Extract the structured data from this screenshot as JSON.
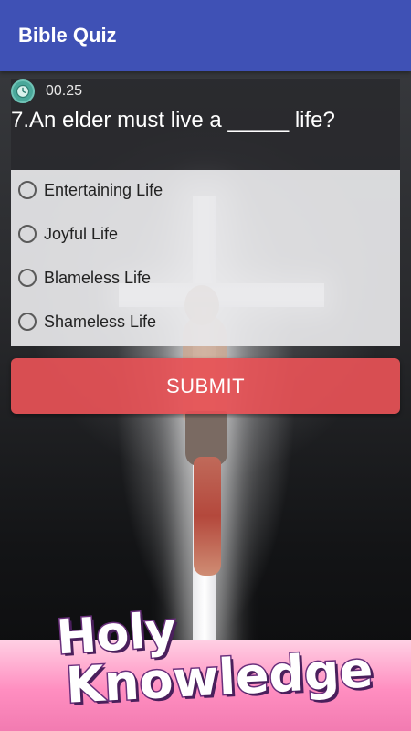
{
  "app": {
    "title": "Bible Quiz",
    "bar_color": "#3f51b5"
  },
  "quiz": {
    "timer": "00.25",
    "timer_icon": "clock-icon",
    "question": "7.An elder must live a _____ life?",
    "options": [
      {
        "label": "Entertaining Life",
        "selected": false
      },
      {
        "label": "Joyful Life",
        "selected": false
      },
      {
        "label": "Blameless Life",
        "selected": false
      },
      {
        "label": "Shameless Life",
        "selected": false
      }
    ],
    "submit_label": "SUBMIT",
    "submit_color": "#e65256"
  },
  "promo": {
    "line1": "Holy",
    "line2": "Knowledge",
    "band_color": "#ff8ec0"
  }
}
